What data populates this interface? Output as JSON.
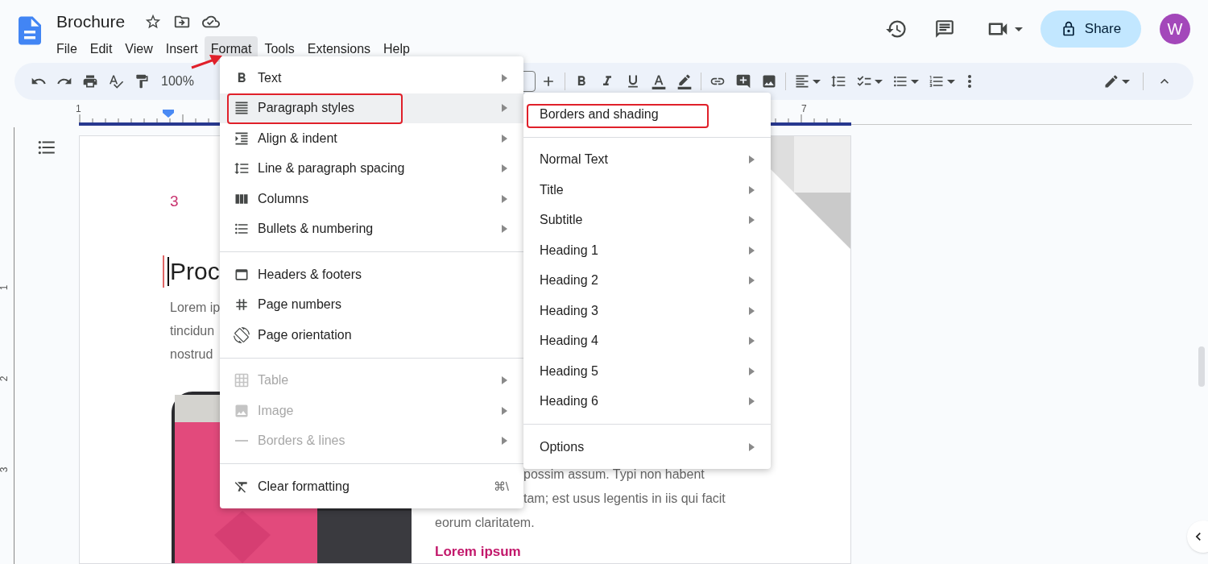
{
  "document": {
    "title": "Brochure"
  },
  "menubar": [
    {
      "label": "File",
      "selected": false
    },
    {
      "label": "Edit",
      "selected": false
    },
    {
      "label": "View",
      "selected": false
    },
    {
      "label": "Insert",
      "selected": false
    },
    {
      "label": "Format",
      "selected": true
    },
    {
      "label": "Tools",
      "selected": false
    },
    {
      "label": "Extensions",
      "selected": false
    },
    {
      "label": "Help",
      "selected": false
    }
  ],
  "share_button": {
    "label": "Share"
  },
  "avatar": {
    "initial": "W"
  },
  "toolbar": {
    "zoom": "100%"
  },
  "ruler": {
    "horizontal_labels": [
      "1",
      "7"
    ],
    "vertical_labels": [
      "1",
      "2",
      "3"
    ]
  },
  "page": {
    "page_number": "3",
    "heading": "Proc",
    "body_lines": [
      "Lorem ip",
      "tincidun",
      "nostrud"
    ],
    "column_lines": [
      "possim assum. Typi non habent",
      "tam; est usus legentis in iis qui facit",
      "eorum claritatem."
    ],
    "subheading": "Lorem ipsum"
  },
  "format_menu": {
    "sections": [
      [
        {
          "label": "Text",
          "selected": false,
          "disabled": false,
          "has_submenu": true,
          "annotated": false
        },
        {
          "label": "Paragraph styles",
          "selected": true,
          "disabled": false,
          "has_submenu": true,
          "annotated": true
        },
        {
          "label": "Align & indent",
          "selected": false,
          "disabled": false,
          "has_submenu": true,
          "annotated": false
        },
        {
          "label": "Line & paragraph spacing",
          "selected": false,
          "disabled": false,
          "has_submenu": true,
          "annotated": false
        },
        {
          "label": "Columns",
          "selected": false,
          "disabled": false,
          "has_submenu": true,
          "annotated": false
        },
        {
          "label": "Bullets & numbering",
          "selected": false,
          "disabled": false,
          "has_submenu": true,
          "annotated": false
        }
      ],
      [
        {
          "label": "Headers & footers",
          "selected": false,
          "disabled": false,
          "has_submenu": false,
          "annotated": false
        },
        {
          "label": "Page numbers",
          "selected": false,
          "disabled": false,
          "has_submenu": false,
          "annotated": false
        },
        {
          "label": "Page orientation",
          "selected": false,
          "disabled": false,
          "has_submenu": false,
          "annotated": false
        }
      ],
      [
        {
          "label": "Table",
          "selected": false,
          "disabled": true,
          "has_submenu": true,
          "annotated": false
        },
        {
          "label": "Image",
          "selected": false,
          "disabled": true,
          "has_submenu": true,
          "annotated": false
        },
        {
          "label": "Borders & lines",
          "selected": false,
          "disabled": true,
          "has_submenu": true,
          "annotated": false
        }
      ],
      [
        {
          "label": "Clear formatting",
          "selected": false,
          "disabled": false,
          "has_submenu": false,
          "annotated": false,
          "shortcut": "⌘\\"
        }
      ]
    ]
  },
  "submenu": {
    "sections": [
      [
        {
          "label": "Borders and shading",
          "has_submenu": false,
          "annotated": true
        }
      ],
      [
        {
          "label": "Normal Text",
          "has_submenu": true,
          "annotated": false
        },
        {
          "label": "Title",
          "has_submenu": true,
          "annotated": false
        },
        {
          "label": "Subtitle",
          "has_submenu": true,
          "annotated": false
        },
        {
          "label": "Heading 1",
          "has_submenu": true,
          "annotated": false
        },
        {
          "label": "Heading 2",
          "has_submenu": true,
          "annotated": false
        },
        {
          "label": "Heading 3",
          "has_submenu": true,
          "annotated": false
        },
        {
          "label": "Heading 4",
          "has_submenu": true,
          "annotated": false
        },
        {
          "label": "Heading 5",
          "has_submenu": true,
          "annotated": false
        },
        {
          "label": "Heading 6",
          "has_submenu": true,
          "annotated": false
        }
      ],
      [
        {
          "label": "Options",
          "has_submenu": true,
          "annotated": false
        }
      ]
    ]
  }
}
